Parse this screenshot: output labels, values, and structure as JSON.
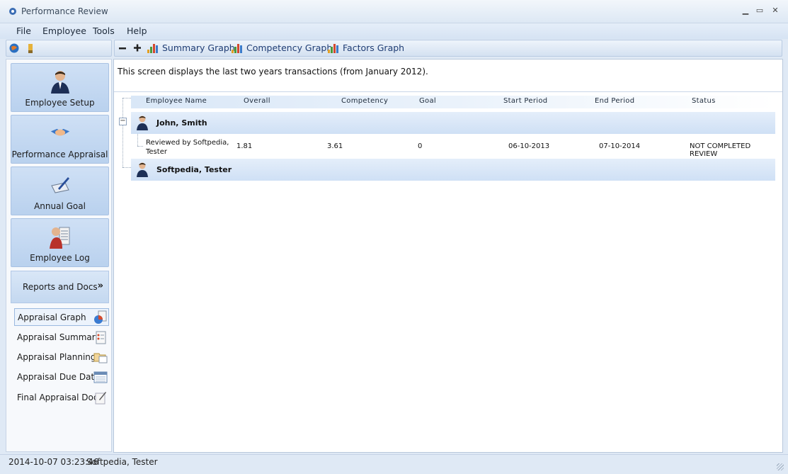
{
  "window": {
    "title": "Performance Review"
  },
  "menu": [
    "File",
    "Employee",
    "Tools",
    "Help"
  ],
  "toolbar": {
    "summary_graph": "Summary Graph",
    "competency_graph": "Competency Graph",
    "factors_graph": "Factors Graph"
  },
  "sidebar": {
    "buttons": [
      "Employee Setup",
      "Performance Appraisal",
      "Annual Goal",
      "Employee Log"
    ],
    "reports": "Reports and Docs",
    "reports_chevron": "»",
    "items": [
      "Appraisal Graph",
      "Appraisal Summary",
      "Appraisal Planning",
      "Appraisal Due Date",
      "Final Appraisal Doc"
    ]
  },
  "main": {
    "info": "This screen displays the last two years transactions (from January 2012).",
    "columns": [
      "Employee Name",
      "Overall",
      "Competency",
      "Goal",
      "Start Period",
      "End Period",
      "Status"
    ],
    "groups": [
      {
        "name": "John, Smith",
        "expander": "−",
        "row": {
          "reviewer_line1": "Reviewed by Softpedia,",
          "reviewer_line2": "Tester",
          "overall": "1.81",
          "competency": "3.61",
          "goal": "0",
          "start": "06-10-2013",
          "end": "07-10-2014",
          "status": "NOT COMPLETED REVIEW"
        }
      },
      {
        "name": "Softpedia, Tester"
      }
    ]
  },
  "status": {
    "time": "2014-10-07 03:23:46",
    "user": "Softpedia, Tester"
  },
  "colors": {
    "accent": "#1f3d74",
    "panel": "#cfe0f5",
    "background": "#dfe9f5"
  }
}
